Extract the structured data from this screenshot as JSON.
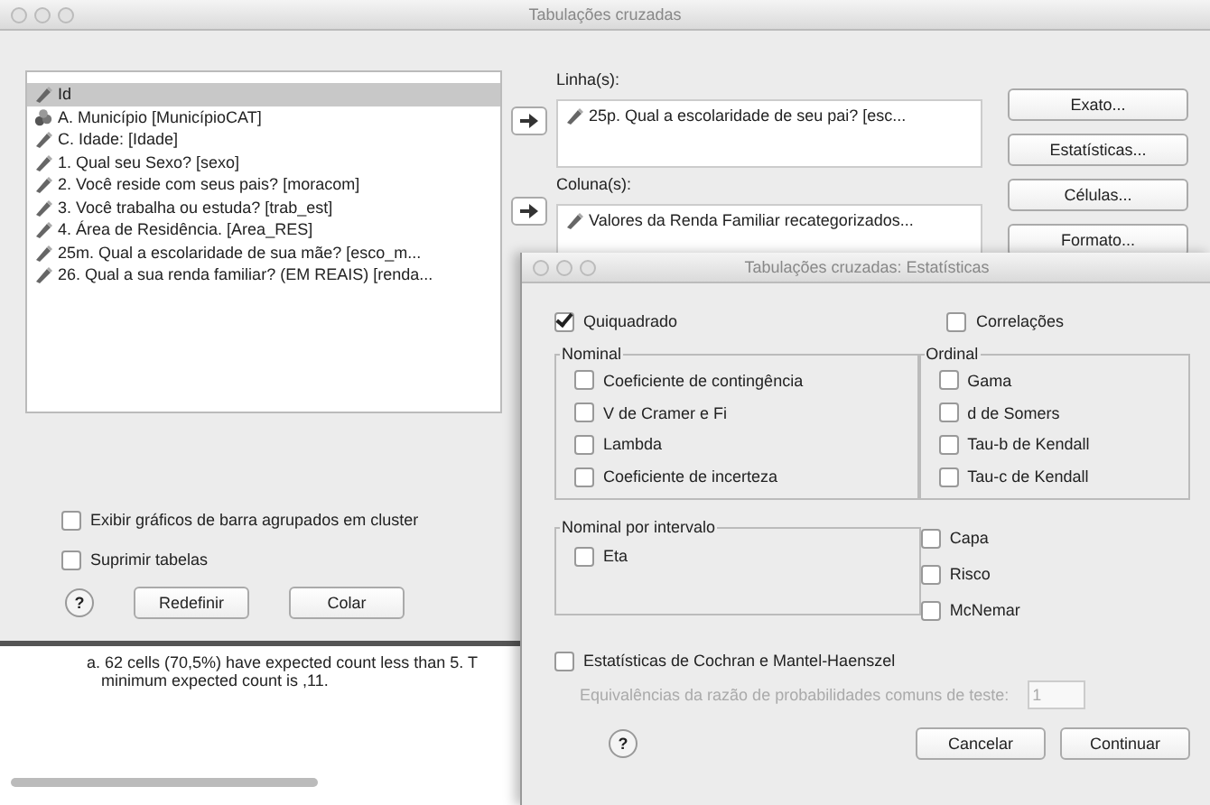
{
  "window": {
    "title": "Tabulações cruzadas"
  },
  "variables": [
    {
      "label": "Id",
      "kind": "scale",
      "selected": true
    },
    {
      "label": "A. Município [MunicípioCAT]",
      "kind": "nominal",
      "selected": false
    },
    {
      "label": "C. Idade: [Idade]",
      "kind": "scale",
      "selected": false
    },
    {
      "label": "1. Qual seu Sexo? [sexo]",
      "kind": "scale",
      "selected": false
    },
    {
      "label": "2. Você reside com seus pais? [moracom]",
      "kind": "scale",
      "selected": false
    },
    {
      "label": "3. Você trabalha ou estuda? [trab_est]",
      "kind": "scale",
      "selected": false
    },
    {
      "label": "4. Área de Residência. [Area_RES]",
      "kind": "scale",
      "selected": false
    },
    {
      "label": "25m. Qual a escolaridade de sua mãe? [esco_m...",
      "kind": "scale",
      "selected": false
    },
    {
      "label": "26. Qual a sua renda familiar? (EM REAIS) [renda...",
      "kind": "scale",
      "selected": false
    }
  ],
  "rows_box": {
    "label": "Linha(s):",
    "items": [
      "25p. Qual a escolaridade de seu pai? [esc..."
    ]
  },
  "columns_box": {
    "label": "Coluna(s):",
    "items": [
      "Valores da Renda Familiar recategorizados..."
    ]
  },
  "side_buttons": [
    "Exato...",
    "Estatísticas...",
    "Células...",
    "Formato..."
  ],
  "options": [
    {
      "label": "Exibir gráficos de barra agrupados em cluster",
      "checked": false
    },
    {
      "label": "Suprimir tabelas",
      "checked": false
    }
  ],
  "help": "?",
  "buttons": [
    "Redefinir",
    "Colar"
  ],
  "output_notes": [
    "a. 62 cells (70,5%) have expected count less than 5. T",
    "minimum expected count is ,11."
  ],
  "dialog": {
    "title": "Tabulações cruzadas: Estatísticas",
    "chi_square": {
      "label": "Quiquadrado",
      "checked": true
    },
    "correlations": {
      "label": "Correlações",
      "checked": false
    },
    "nominal": {
      "title": "Nominal",
      "items": [
        {
          "label": "Coeficiente de contingência",
          "checked": false
        },
        {
          "label": "V de Cramer e Fi",
          "checked": false
        },
        {
          "label": "Lambda",
          "checked": false
        },
        {
          "label": "Coeficiente de incerteza",
          "checked": false
        }
      ]
    },
    "ordinal": {
      "title": "Ordinal",
      "items": [
        {
          "label": "Gama",
          "checked": false
        },
        {
          "label": "d de Somers",
          "checked": false
        },
        {
          "label": "Tau-b de Kendall",
          "checked": false
        },
        {
          "label": "Tau-c de Kendall",
          "checked": false
        }
      ]
    },
    "interval": {
      "title": "Nominal por intervalo",
      "items": [
        {
          "label": "Eta",
          "checked": false
        }
      ]
    },
    "other": [
      {
        "label": "Capa",
        "checked": false
      },
      {
        "label": "Risco",
        "checked": false
      },
      {
        "label": "McNemar",
        "checked": false
      }
    ],
    "cmh": {
      "label": "Estatísticas de Cochran e Mantel-Haenszel",
      "checked": false
    },
    "test_value": {
      "label": "Equivalências da razão de probabilidades comuns de teste:",
      "value": "1",
      "disabled": true
    },
    "help": "?",
    "buttons": [
      "Cancelar",
      "Continuar"
    ]
  }
}
